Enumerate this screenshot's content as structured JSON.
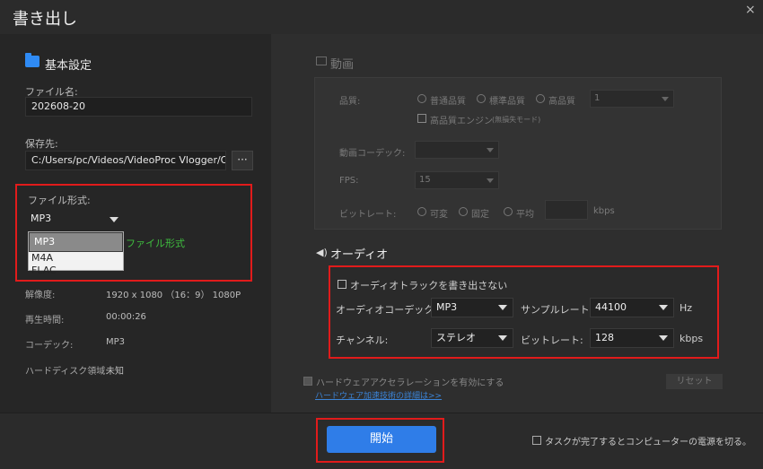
{
  "window": {
    "title": "書き出し",
    "close_glyph": "×"
  },
  "basic": {
    "section_title": "基本設定",
    "filename_label": "ファイル名:",
    "filename_value": "202608-20",
    "save_label": "保存先:",
    "save_path": "C:/Users/pc/Videos/VideoProc Vlogger/Output",
    "browse_glyph": "···",
    "format_label": "ファイル形式:",
    "format_value": "MP3",
    "format_options": [
      "MP3",
      "M4A",
      "FLAC"
    ],
    "format_hint": "ファイル形式",
    "resolution_label": "解像度:",
    "resolution_value": "1920 x 1080 （16：9） 1080P",
    "duration_label": "再生時間:",
    "duration_value": "00:00:26",
    "codec_label": "コーデック:",
    "codec_value": "MP3",
    "disk_label": "ハードディスク領域:",
    "disk_value": "未知"
  },
  "video": {
    "title": "動画",
    "quality_label": "品質:",
    "quality_options": [
      "普通品質",
      "標準品質",
      "高品質"
    ],
    "quality_select": "1",
    "hq_engine_label": "高品質エンジン",
    "hq_engine_note": "(無損失モード)",
    "codec_label": "動画コーデック:",
    "fps_label": "FPS:",
    "fps_value": "15",
    "bitrate_label": "ビットレート:",
    "bitrate_options": [
      "可変",
      "固定",
      "平均"
    ],
    "bitrate_unit": "kbps"
  },
  "audio": {
    "title": "オーディオ",
    "no_export_label": "オーディオトラックを書き出さない",
    "codec_label": "オーディオコーデック:",
    "codec_value": "MP3",
    "samplerate_label": "サンプルレート:",
    "samplerate_value": "44100",
    "samplerate_unit": "Hz",
    "channel_label": "チャンネル:",
    "channel_value": "ステレオ",
    "bitrate_label": "ビットレート:",
    "bitrate_value": "128",
    "bitrate_unit": "kbps"
  },
  "hw": {
    "accel_label": "ハードウェアアクセラレーションを有効にする",
    "detail_link": "ハードウェア加速技術の詳細は>>",
    "reset_label": "リセット"
  },
  "footer": {
    "start_label": "開始",
    "shutdown_label": "タスクが完了するとコンピューターの電源を切る。"
  }
}
